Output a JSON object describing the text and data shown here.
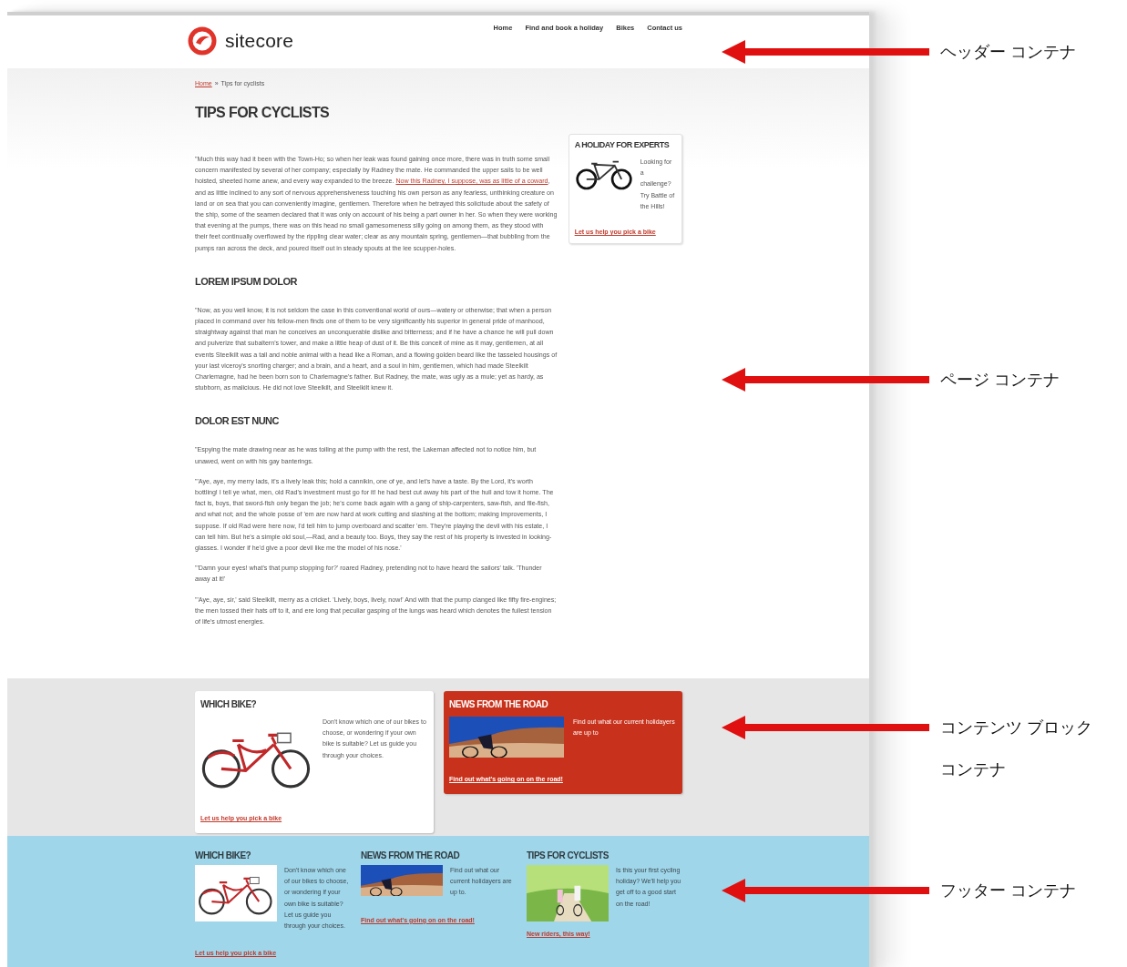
{
  "header": {
    "logo": "sitecore",
    "nav": [
      "Home",
      "Find and book a holiday",
      "Bikes",
      "Contact us"
    ]
  },
  "breadcrumb": {
    "link": "Home",
    "separator": "»",
    "current": "Tips for cyclists"
  },
  "title": "TIPS FOR CYCLISTS",
  "article": [
    {
      "paragraphs": [
        [
          {
            "kind": "text",
            "text": "\"Much this way had it been with the Town-Ho; so when her leak was found gaining once more, there was in truth some small concern manifested by several of her company; especially by Radney the mate. He commanded the upper sails to be well hoisted, sheeted home anew, and every way expanded to the breeze. "
          },
          {
            "kind": "link",
            "text": "Now this Radney, I suppose, was as little of a coward"
          },
          {
            "kind": "text",
            "text": ", and as little inclined to any sort of nervous apprehensiveness touching his own person as any fearless, unthinking creature on land or on sea that you can conveniently imagine, gentlemen. Therefore when he betrayed this solicitude about the safety of the ship, some of the seamen declared that it was only on account of his being a part owner in her. So when they were working that evening at the pumps, there was on this head no small gamesomeness silly going on among them, as they stood with their feet continually overflowed by the rippling clear water; clear as any mountain spring, gentlemen—that bubbling from the pumps ran across the deck, and poured itself out in steady spouts at the lee scupper-holes."
          }
        ]
      ]
    },
    {
      "heading": "LOREM IPSUM DOLOR",
      "paragraphs": [
        [
          {
            "kind": "text",
            "text": "\"Now, as you well know, it is not seldom the case in this conventional world of ours—watery or otherwise; that when a person placed in command over his fellow-men finds one of them to be very significantly his superior in general pride of manhood, straightway against that man he conceives an unconquerable dislike and bitterness; and if he have a chance he will pull down and pulverize that subaltern's tower, and make a little heap of dust of it. Be this conceit of mine as it may, gentlemen, at all events Steelkilt was a tall and noble animal with a head like a Roman, and a flowing golden beard like the tasseled housings of your last viceroy's snorting charger; and a brain, and a heart, and a soul in him, gentlemen, which had made Steelkilt Charlemagne, had he been born son to Charlemagne's father. But Radney, the mate, was ugly as a mule; yet as hardy, as stubborn, as malicious. He did not love Steelkilt, and Steelkilt knew it."
          }
        ]
      ]
    },
    {
      "heading": "DOLOR EST NUNC",
      "paragraphs": [
        [
          {
            "kind": "text",
            "text": "\"Espying the mate drawing near as he was toiling at the pump with the rest, the Lakeman affected not to notice him, but unawed, went on with his gay banterings."
          }
        ],
        [
          {
            "kind": "text",
            "text": "\"'Aye, aye, my merry lads, it's a lively leak this; hold a cannikin, one of ye, and let's have a taste. By the Lord, it's worth bottling! I tell ye what, men, old Rad's investment must go for it! he had best cut away his part of the hull and tow it home. The fact is, boys, that sword-fish only began the job; he's come back again with a gang of ship-carpenters, saw-fish, and file-fish, and what not; and the whole posse of 'em are now hard at work cutting and slashing at the bottom; making improvements, I suppose. If old Rad were here now, I'd tell him to jump overboard and scatter 'em. They're playing the devil with his estate, I can tell him. But he's a simple old soul,—Rad, and a beauty too. Boys, they say the rest of his property is invested in looking-glasses. I wonder if he'd give a poor devil like me the model of his nose.'"
          }
        ],
        [
          {
            "kind": "text",
            "text": "\"'Damn your eyes! what's that pump stopping for?' roared Radney, pretending not to have heard the sailors' talk. 'Thunder away at it!'"
          }
        ],
        [
          {
            "kind": "text",
            "text": "\"'Aye, aye, sir,' said Steelkilt, merry as a cricket. 'Lively, boys, lively, now!' And with that the pump clanged like fifty fire-engines; the men tossed their hats off to it, and ere long that peculiar gasping of the lungs was heard which denotes the fullest tension of life's utmost energies."
          }
        ]
      ]
    }
  ],
  "sidebar_box": {
    "title": "A HOLIDAY FOR EXPERTS",
    "text": "Looking for a challenge? Try Battle of the Hills!",
    "link": "Let us help you pick a bike"
  },
  "content_blocks": [
    {
      "kind": "white",
      "title": "WHICH BIKE?",
      "text": "Don't know which one of our bikes to choose, or wondering if your own bike is suitable? Let us guide you through your choices.",
      "link": "Let us help you pick a bike"
    },
    {
      "kind": "red",
      "title": "NEWS FROM THE ROAD",
      "text": "Find out what our current holidayers are up to",
      "link": "Find out what's going on on the road!"
    }
  ],
  "footer": [
    {
      "title": "WHICH BIKE?",
      "text": "Don't know which one of our bikes to choose, or wondering if your own bike is suitable? Let us guide you through your choices.",
      "link": "Let us help you pick a bike"
    },
    {
      "title": "NEWS FROM THE ROAD",
      "text": "Find out what our current holidayers are up to.",
      "link": "Find out what's going on on the road!"
    },
    {
      "title": "TIPS FOR CYCLISTS",
      "text": "Is this your first cycling holiday? We'll help you get off to a good start on the road!",
      "link": "New riders, this way!"
    }
  ],
  "annotations": [
    {
      "lines": [
        "ヘッダー コンテナ"
      ]
    },
    {
      "lines": [
        "ページ コンテナ"
      ]
    },
    {
      "lines": [
        "コンテンツ ブロック",
        "コンテナ"
      ]
    },
    {
      "lines": [
        "フッター コンテナ"
      ]
    }
  ]
}
